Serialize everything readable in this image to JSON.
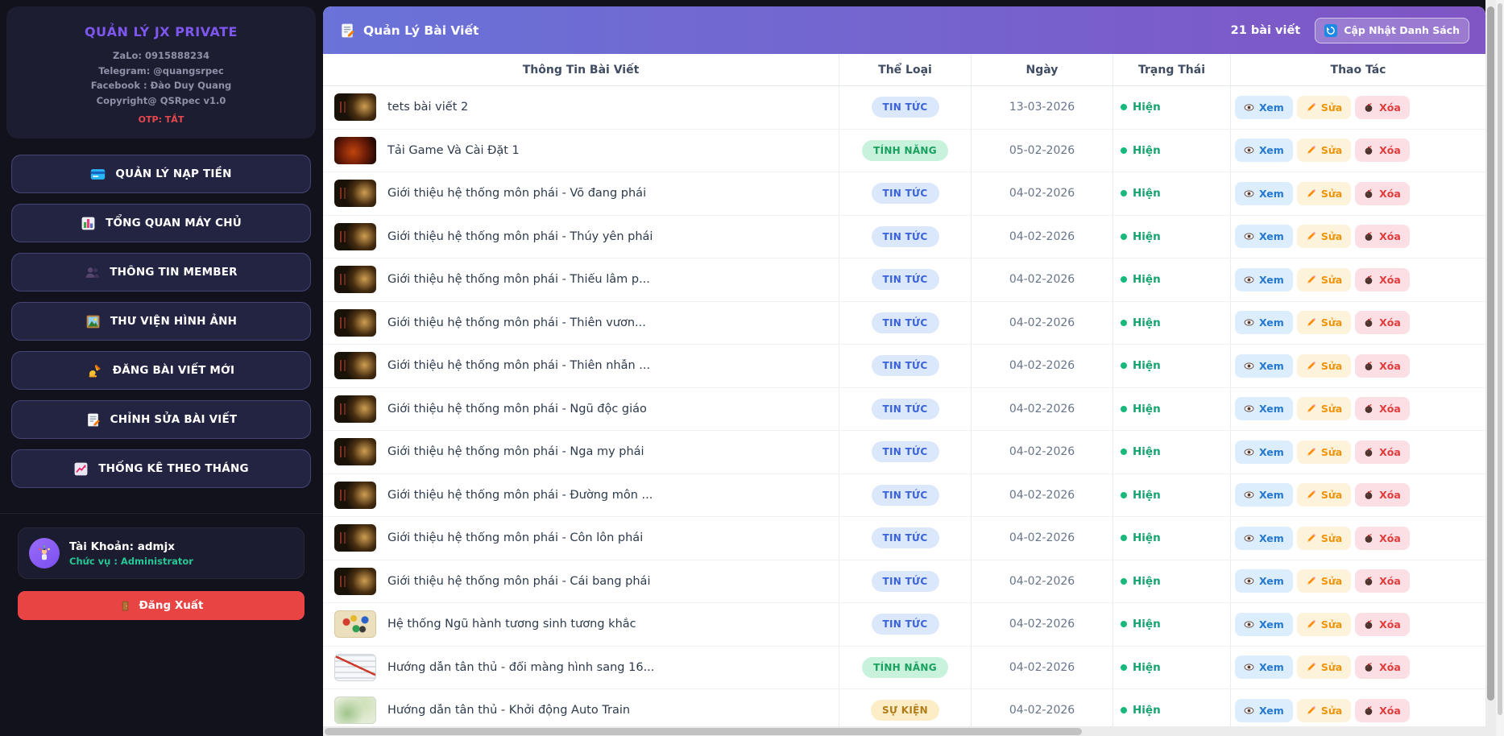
{
  "sidebar": {
    "title": "QUẢN LÝ JX PRIVATE",
    "info_lines": [
      "ZaLo: 0915888234",
      "Telegram: @quangsrpec",
      "Facebook : Đào Duy Quang",
      "Copyright@ QSRpec v1.0"
    ],
    "otp_status": "OTP: TẮT",
    "menu": [
      {
        "key": "nap-tien",
        "icon": "credit-card",
        "label": "QUẢN LÝ NẠP TIỀN"
      },
      {
        "key": "tong-quan",
        "icon": "bar-chart",
        "label": "TỔNG QUAN MÁY CHỦ"
      },
      {
        "key": "member",
        "icon": "users",
        "label": "THÔNG TIN MEMBER"
      },
      {
        "key": "thu-vien-anh",
        "icon": "picture",
        "label": "THƯ VIỆN HÌNH ẢNH"
      },
      {
        "key": "dang-bai-moi",
        "icon": "writing",
        "label": "ĐĂNG BÀI VIẾT MỚI"
      },
      {
        "key": "chinh-sua-bai",
        "icon": "memo",
        "label": "CHỈNH SỬA BÀI VIẾT"
      },
      {
        "key": "thong-ke",
        "icon": "chart-up",
        "label": "THỐNG KÊ THEO THÁNG"
      }
    ],
    "user": {
      "avatar_icon": "juggler",
      "account_label": "Tài Khoản: admjx",
      "role_label": "Chức vụ : Administrator"
    },
    "logout_icon": "door",
    "logout_label": "Đăng Xuất"
  },
  "header": {
    "icon": "memo",
    "title": "Quản Lý Bài Viết",
    "count_label": "21 bài viết",
    "refresh_button": {
      "icon": "refresh",
      "label": "Cập Nhật Danh Sách"
    }
  },
  "table": {
    "columns": [
      "Thông Tin Bài Viết",
      "Thể Loại",
      "Ngày",
      "Trạng Thái",
      "Thao Tác"
    ],
    "categories": {
      "news": {
        "label": "TIN TỨC",
        "bg": "#dbe7fb",
        "fg": "#3b63d8"
      },
      "feature": {
        "label": "TÍNH NĂNG",
        "bg": "#c9f2dd",
        "fg": "#18a05f"
      },
      "event": {
        "label": "SỰ KIỆN",
        "bg": "#fcedc6",
        "fg": "#b07c18"
      }
    },
    "status_colors": {
      "visible_dot": "#18b97a",
      "visible_text": "#16a370"
    },
    "actions": [
      {
        "icon": "eye",
        "label": "Xem",
        "style": "view"
      },
      {
        "icon": "pencil",
        "label": "Sửa",
        "style": "edit"
      },
      {
        "icon": "bomb",
        "label": "Xóa",
        "style": "delete"
      }
    ],
    "rows": [
      {
        "title": "tets bài viết 2",
        "category": "news",
        "date": "13-03-2026",
        "status": "Hiện",
        "thumb": "dark-ui"
      },
      {
        "title": "Tải Game Và Cài Đặt 1",
        "category": "feature",
        "date": "05-02-2026",
        "status": "Hiện",
        "thumb": "fire"
      },
      {
        "title": "Giới thiệu hệ thống môn phái - Võ đang phái",
        "category": "news",
        "date": "04-02-2026",
        "status": "Hiện",
        "thumb": "dark-ui"
      },
      {
        "title": "Giới thiệu hệ thống môn phái - Thúy yên phái",
        "category": "news",
        "date": "04-02-2026",
        "status": "Hiện",
        "thumb": "dark-ui"
      },
      {
        "title": "Giới thiệu hệ thống môn phái - Thiếu lâm p...",
        "category": "news",
        "date": "04-02-2026",
        "status": "Hiện",
        "thumb": "dark-ui"
      },
      {
        "title": "Giới thiệu hệ thống môn phái - Thiên vươn...",
        "category": "news",
        "date": "04-02-2026",
        "status": "Hiện",
        "thumb": "dark-ui"
      },
      {
        "title": "Giới thiệu hệ thống môn phái - Thiên nhẫn ...",
        "category": "news",
        "date": "04-02-2026",
        "status": "Hiện",
        "thumb": "dark-ui"
      },
      {
        "title": "Giới thiệu hệ thống môn phái - Ngũ độc giáo",
        "category": "news",
        "date": "04-02-2026",
        "status": "Hiện",
        "thumb": "dark-ui"
      },
      {
        "title": "Giới thiệu hệ thống môn phái - Nga my phái",
        "category": "news",
        "date": "04-02-2026",
        "status": "Hiện",
        "thumb": "dark-ui"
      },
      {
        "title": "Giới thiệu hệ thống môn phái - Đường môn ...",
        "category": "news",
        "date": "04-02-2026",
        "status": "Hiện",
        "thumb": "dark-ui"
      },
      {
        "title": "Giới thiệu hệ thống môn phái - Côn lôn phái",
        "category": "news",
        "date": "04-02-2026",
        "status": "Hiện",
        "thumb": "dark-ui"
      },
      {
        "title": "Giới thiệu hệ thống môn phái - Cái bang phái",
        "category": "news",
        "date": "04-02-2026",
        "status": "Hiện",
        "thumb": "dark-ui"
      },
      {
        "title": "Hệ thống Ngũ hành tương sinh tương khắc",
        "category": "news",
        "date": "04-02-2026",
        "status": "Hiện",
        "thumb": "parchment"
      },
      {
        "title": "Hướng dẫn tân thủ - đổi màng hình sang 16...",
        "category": "feature",
        "date": "04-02-2026",
        "status": "Hiện",
        "thumb": "screenshot"
      },
      {
        "title": "Hướng dẫn tân thủ - Khởi động Auto Train",
        "category": "event",
        "date": "04-02-2026",
        "status": "Hiện",
        "thumb": "map"
      }
    ]
  }
}
